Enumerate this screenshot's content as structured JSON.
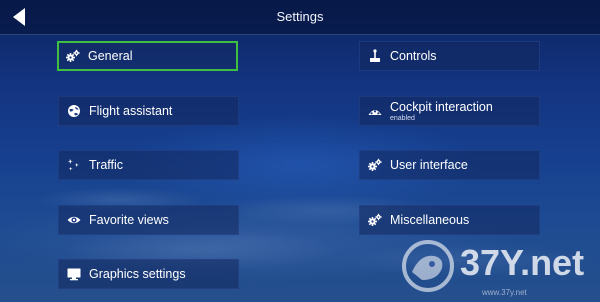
{
  "header": {
    "title": "Settings",
    "back_icon": "back-arrow-icon"
  },
  "menu": {
    "left": [
      {
        "label": "General",
        "icon": "gears-icon",
        "selected": true
      },
      {
        "label": "Flight assistant",
        "icon": "globe-icon"
      },
      {
        "label": "Traffic",
        "icon": "traffic-icon"
      },
      {
        "label": "Favorite views",
        "icon": "eye-icon"
      },
      {
        "label": "Graphics settings",
        "icon": "monitor-icon"
      }
    ],
    "right": [
      {
        "label": "Controls",
        "icon": "joystick-icon"
      },
      {
        "label": "Cockpit interaction",
        "sublabel": "enabled",
        "icon": "cockpit-icon"
      },
      {
        "label": "User interface",
        "icon": "gears-icon"
      },
      {
        "label": "Miscellaneous",
        "icon": "gears-icon"
      }
    ]
  },
  "colors": {
    "selection_border": "#3fbf3f",
    "background_top": "#0d2461",
    "background_bottom": "#254f8c"
  },
  "watermark": {
    "text": "37Y.net",
    "url": "www.37y.net"
  }
}
